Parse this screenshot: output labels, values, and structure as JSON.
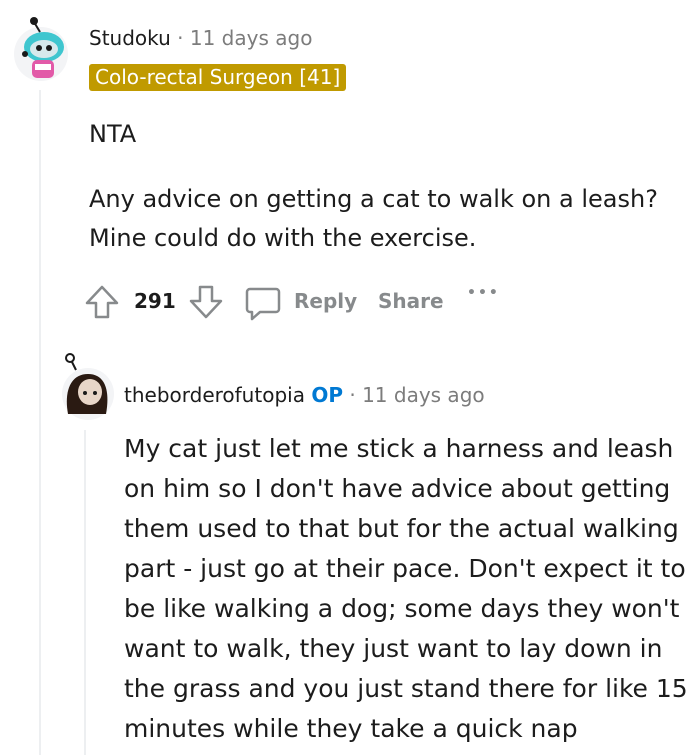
{
  "comment": {
    "username": "Studoku",
    "separator": "·",
    "time": "11 days ago",
    "flair": "Colo-rectal Surgeon [41]",
    "paragraphs": [
      "NTA",
      "Any advice on getting a cat to walk on a leash?",
      "Mine could do with the exercise."
    ],
    "score": "291",
    "reply_label": "Reply",
    "share_label": "Share",
    "more_label": "•••",
    "icons": {
      "upvote": "upvote-arrow-icon",
      "downvote": "downvote-arrow-icon",
      "reply": "speech-bubble-icon",
      "avatar": "snoo-avatar-cyan"
    }
  },
  "reply": {
    "username": "theborderofutopia",
    "op_badge": "OP",
    "separator": "·",
    "time": "11 days ago",
    "body": "My cat just let me stick a harness and leash on him so I don't have advice about getting them used to that but for the actual walking part - just go at their pace. Don't expect it to be like walking a dog; some days they won't want to walk, they just want to lay down in the grass and you just stand there for like 15 minutes while they take a quick nap",
    "icons": {
      "avatar": "snoo-avatar-dark-hair"
    }
  },
  "colors": {
    "flair_bg": "#c09a00",
    "op_blue": "#0079d3",
    "muted_gray": "#878a8c",
    "thread_line": "#edeff1"
  }
}
